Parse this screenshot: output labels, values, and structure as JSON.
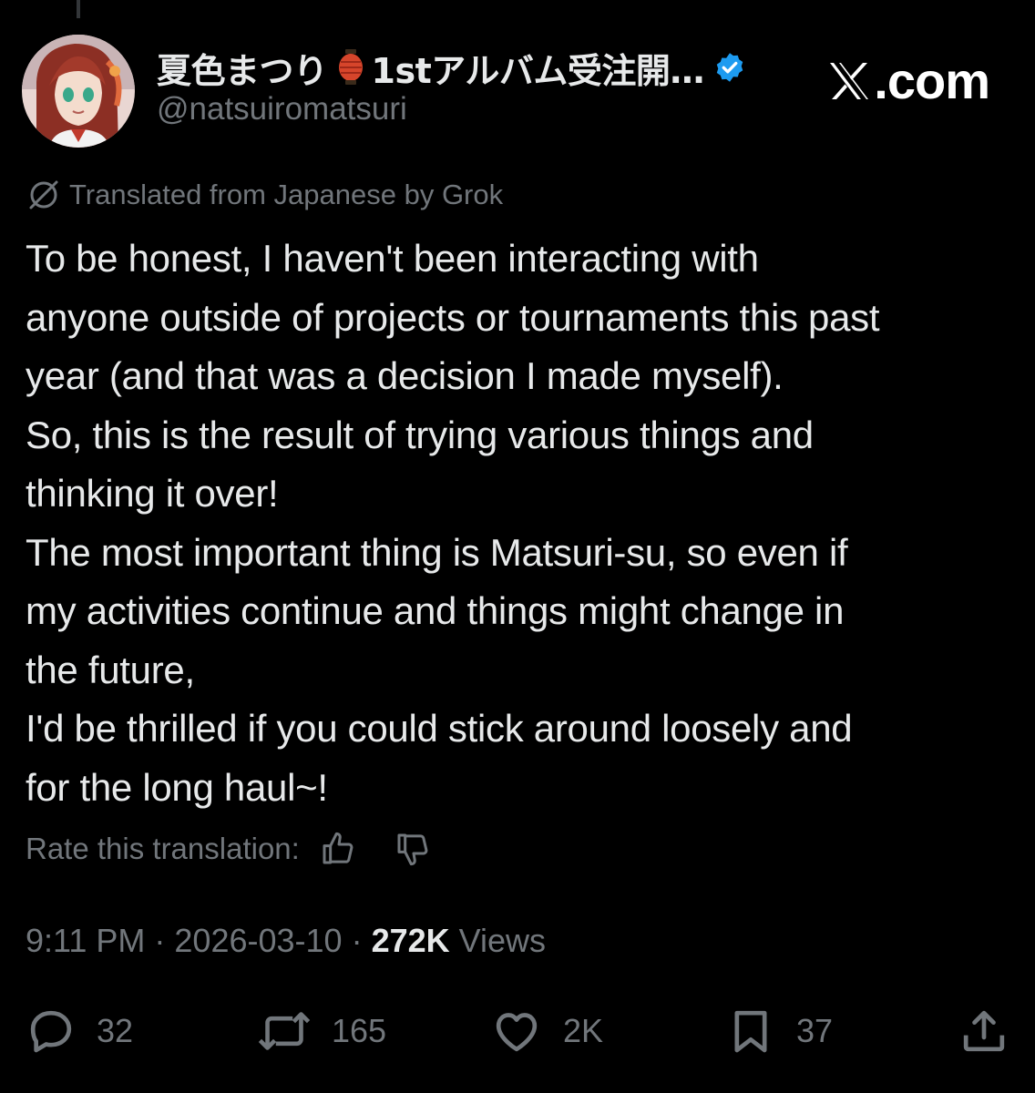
{
  "header": {
    "display_name": "夏色まつり",
    "display_name_suffix": "1stアルバム受注開…",
    "handle": "@natsuiromatsuri",
    "brand_label": ".com",
    "icons": {
      "lantern": "paper-lantern-emoji",
      "verified": "verified-badge-icon",
      "brand": "x-logo-icon"
    },
    "colors": {
      "verified": "#1d9bf0",
      "lantern": "#d6452b"
    }
  },
  "translation": {
    "label": "Translated from Japanese by Grok",
    "icon": "grok-icon"
  },
  "tweet": {
    "lines": [
      "To be honest, I haven't been interacting with",
      "anyone outside of projects or tournaments this past",
      "year (and that was a decision I made myself).",
      "So, this is the result of trying various things and",
      "thinking it over!",
      "The most important thing is Matsuri-su, so even if",
      "my activities continue and things might change in",
      "the future,",
      "I'd be thrilled if you could stick around loosely and",
      "for the long haul~!"
    ]
  },
  "rating": {
    "label": "Rate this translation:",
    "icons": [
      "thumbs-up-icon",
      "thumbs-down-icon"
    ]
  },
  "meta": {
    "time": "9:11 PM",
    "separator": " · ",
    "date": "2026-03-10",
    "views_count": "272K",
    "views_label": " Views"
  },
  "actions": {
    "replies": "32",
    "reposts": "165",
    "likes": "2K",
    "bookmarks": "37",
    "icons": [
      "reply-icon",
      "repost-icon",
      "like-icon",
      "bookmark-icon",
      "share-icon"
    ]
  },
  "colors": {
    "background": "#000000",
    "text": "#e7e9ea",
    "secondary": "#71767b"
  }
}
